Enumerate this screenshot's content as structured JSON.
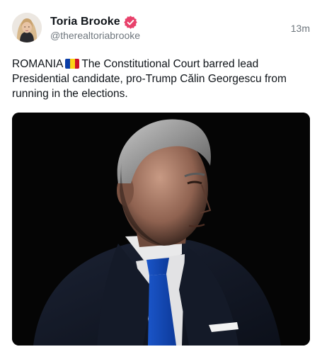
{
  "post": {
    "author": {
      "display_name": "Toria Brooke",
      "handle": "@therealtoriabrooke",
      "verified_icon": "verified-badge-icon",
      "verified_color": "#e8416b"
    },
    "timestamp": "13m",
    "text": {
      "before_flag": "ROMANIA",
      "flag_icon": "romania-flag-icon",
      "flag_colors": [
        "#0b3ea8",
        "#fcd116",
        "#ce1126"
      ],
      "after_flag": "The Constitutional Court barred lead Presidential candidate, pro-Trump Călin Georgescu from running in the elections."
    },
    "media": {
      "type": "photo",
      "background_color": "#050505"
    }
  }
}
